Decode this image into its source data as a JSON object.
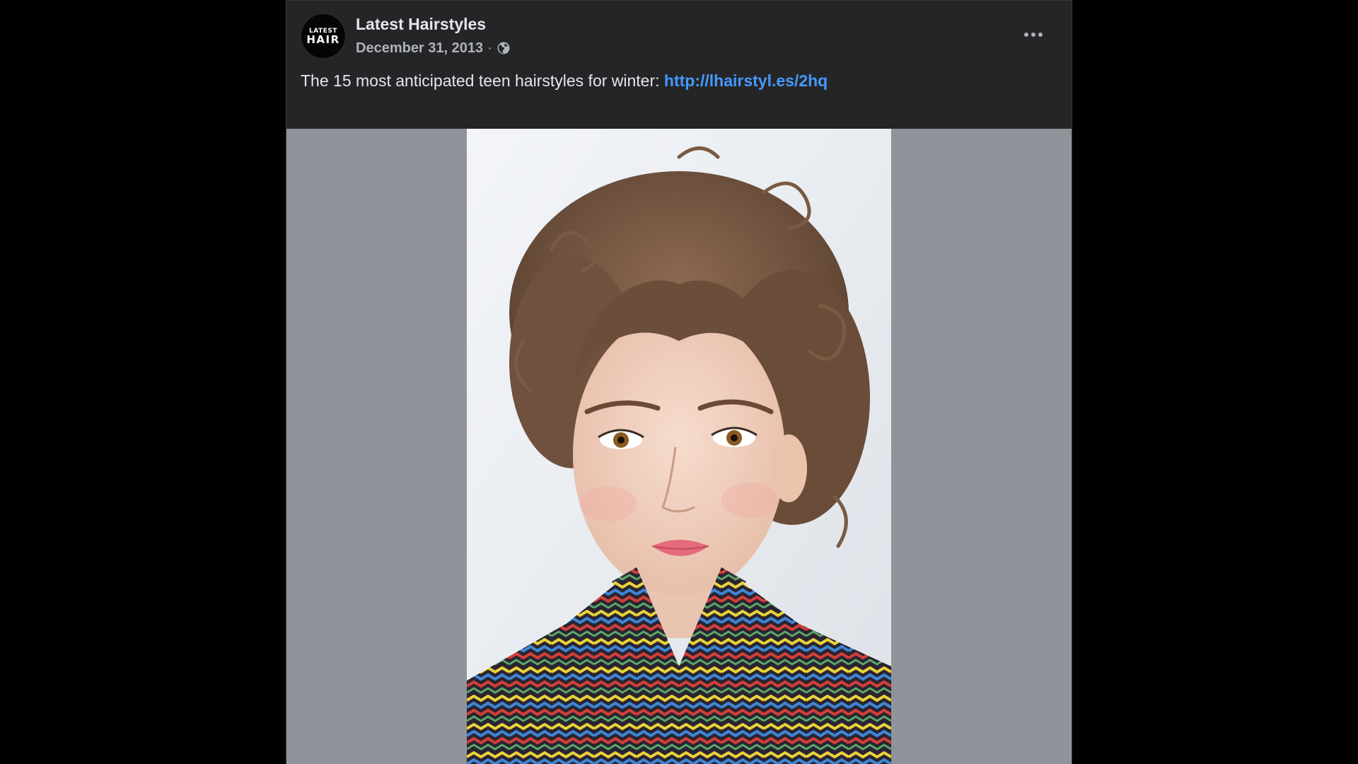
{
  "post": {
    "page_name": "Latest Hairstyles",
    "avatar": {
      "line1": "LATEST",
      "line2": "HAIR"
    },
    "date": "December 31, 2013",
    "separator": "·",
    "audience_icon": "globe-icon",
    "more_icon": "more-options-icon",
    "text": "The 15 most anticipated teen hairstyles for winter:",
    "link": "http://lhairstyl.es/2hq"
  },
  "media": {
    "photo_icon": "portrait-photo"
  },
  "colors": {
    "page_background": "#000000",
    "card_background": "#242526",
    "primary_text": "#e4e6eb",
    "secondary_text": "#b0b3b8",
    "link": "#4599ff",
    "media_background": "#909399"
  }
}
